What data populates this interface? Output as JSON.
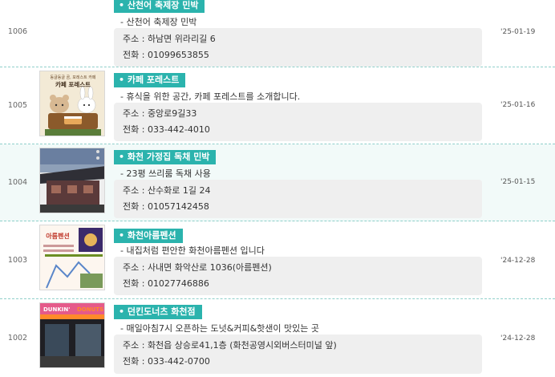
{
  "rows": [
    {
      "num": "1006",
      "tag": "• 산천어 축제장 민박",
      "desc": "- 산천어 축제장 민박",
      "address": "주소 : 하남면 위라리길 6",
      "phone": "전화 : 01099653855",
      "date": "'25-01-19"
    },
    {
      "num": "1005",
      "tag": "• 카페 포레스트",
      "desc": "- 휴식을 위한 공간, 카페 포레스트를 소개합니다.",
      "address": "주소 : 중앙로9길33",
      "phone": "전화 : 033-442-4010",
      "date": "'25-01-16",
      "thumb_text": [
        "동글동글 곰, 포레스트 카페",
        "카페 포레스트"
      ]
    },
    {
      "num": "1004",
      "tag": "• 화천 가정집 독채 민박",
      "desc": "- 23평 쓰리룸 독채 사용",
      "address": "주소 : 산수화로 1길 24",
      "phone": "전화 : 01057142458",
      "date": "'25-01-15"
    },
    {
      "num": "1003",
      "tag": "• 화천아름펜션",
      "desc": "- 내집처럼 편안한 화천아름펜션 입니다",
      "address": "주소 : 사내면 화악산로 1036(아름펜션)",
      "phone": "전화 : 01027746886",
      "date": "'24-12-28",
      "thumb_text": [
        "아름펜션"
      ]
    },
    {
      "num": "1002",
      "tag": "• 던킨도너츠 화천점",
      "desc": "- 매일아침7시 오픈하는 도넛&커피&핫샌이 맛있는 곳",
      "address": "주소 : 화천읍 상승로41,1층 (화천공영시외버스터미널 앞)",
      "phone": "전화 : 033-442-0700",
      "date": "'24-12-28",
      "thumb_text": [
        "DUNKIN'",
        "DONUTS"
      ]
    }
  ]
}
